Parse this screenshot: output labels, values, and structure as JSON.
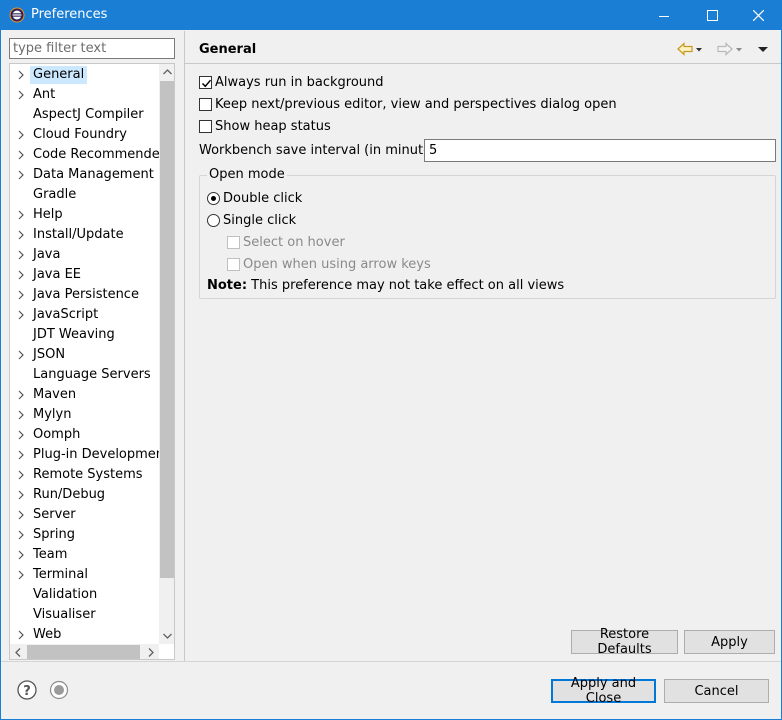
{
  "window": {
    "title": "Preferences",
    "accent_color": "#1a7fd4",
    "controls": [
      "minimize-icon",
      "maximize-icon",
      "close-icon"
    ]
  },
  "sidebar": {
    "filter_placeholder": "type filter text",
    "selected": "General",
    "items": [
      {
        "label": "General",
        "expandable": true
      },
      {
        "label": "Ant",
        "expandable": true
      },
      {
        "label": "AspectJ Compiler",
        "expandable": false
      },
      {
        "label": "Cloud Foundry",
        "expandable": true
      },
      {
        "label": "Code Recommenders",
        "expandable": true
      },
      {
        "label": "Data Management",
        "expandable": true
      },
      {
        "label": "Gradle",
        "expandable": false
      },
      {
        "label": "Help",
        "expandable": true
      },
      {
        "label": "Install/Update",
        "expandable": true
      },
      {
        "label": "Java",
        "expandable": true
      },
      {
        "label": "Java EE",
        "expandable": true
      },
      {
        "label": "Java Persistence",
        "expandable": true
      },
      {
        "label": "JavaScript",
        "expandable": true
      },
      {
        "label": "JDT Weaving",
        "expandable": false
      },
      {
        "label": "JSON",
        "expandable": true
      },
      {
        "label": "Language Servers",
        "expandable": false
      },
      {
        "label": "Maven",
        "expandable": true
      },
      {
        "label": "Mylyn",
        "expandable": true
      },
      {
        "label": "Oomph",
        "expandable": true
      },
      {
        "label": "Plug-in Development",
        "expandable": true
      },
      {
        "label": "Remote Systems",
        "expandable": true
      },
      {
        "label": "Run/Debug",
        "expandable": true
      },
      {
        "label": "Server",
        "expandable": true
      },
      {
        "label": "Spring",
        "expandable": true
      },
      {
        "label": "Team",
        "expandable": true
      },
      {
        "label": "Terminal",
        "expandable": true
      },
      {
        "label": "Validation",
        "expandable": false
      },
      {
        "label": "Visualiser",
        "expandable": false
      },
      {
        "label": "Web",
        "expandable": true
      }
    ]
  },
  "page": {
    "title": "General",
    "options": {
      "always_run_background": {
        "label": "Always run in background",
        "checked": true
      },
      "keep_next_prev": {
        "label": "Keep next/previous editor, view and perspectives dialog open",
        "checked": false
      },
      "show_heap": {
        "label": "Show heap status",
        "checked": false
      }
    },
    "save_interval": {
      "label": "Workbench save interval (in minutes):",
      "value": "5"
    },
    "open_mode": {
      "title": "Open mode",
      "double_click": {
        "label": "Double click",
        "selected": true
      },
      "single_click": {
        "label": "Single click",
        "selected": false
      },
      "select_on_hover": {
        "label": "Select on hover",
        "checked": false,
        "enabled": false
      },
      "open_arrow_keys": {
        "label": "Open when using arrow keys",
        "checked": false,
        "enabled": false
      },
      "note_bold": "Note:",
      "note_text": " This preference may not take effect on all views"
    },
    "restore_defaults": "Restore Defaults",
    "apply": "Apply"
  },
  "footer": {
    "apply_close": "Apply and Close",
    "cancel": "Cancel"
  }
}
